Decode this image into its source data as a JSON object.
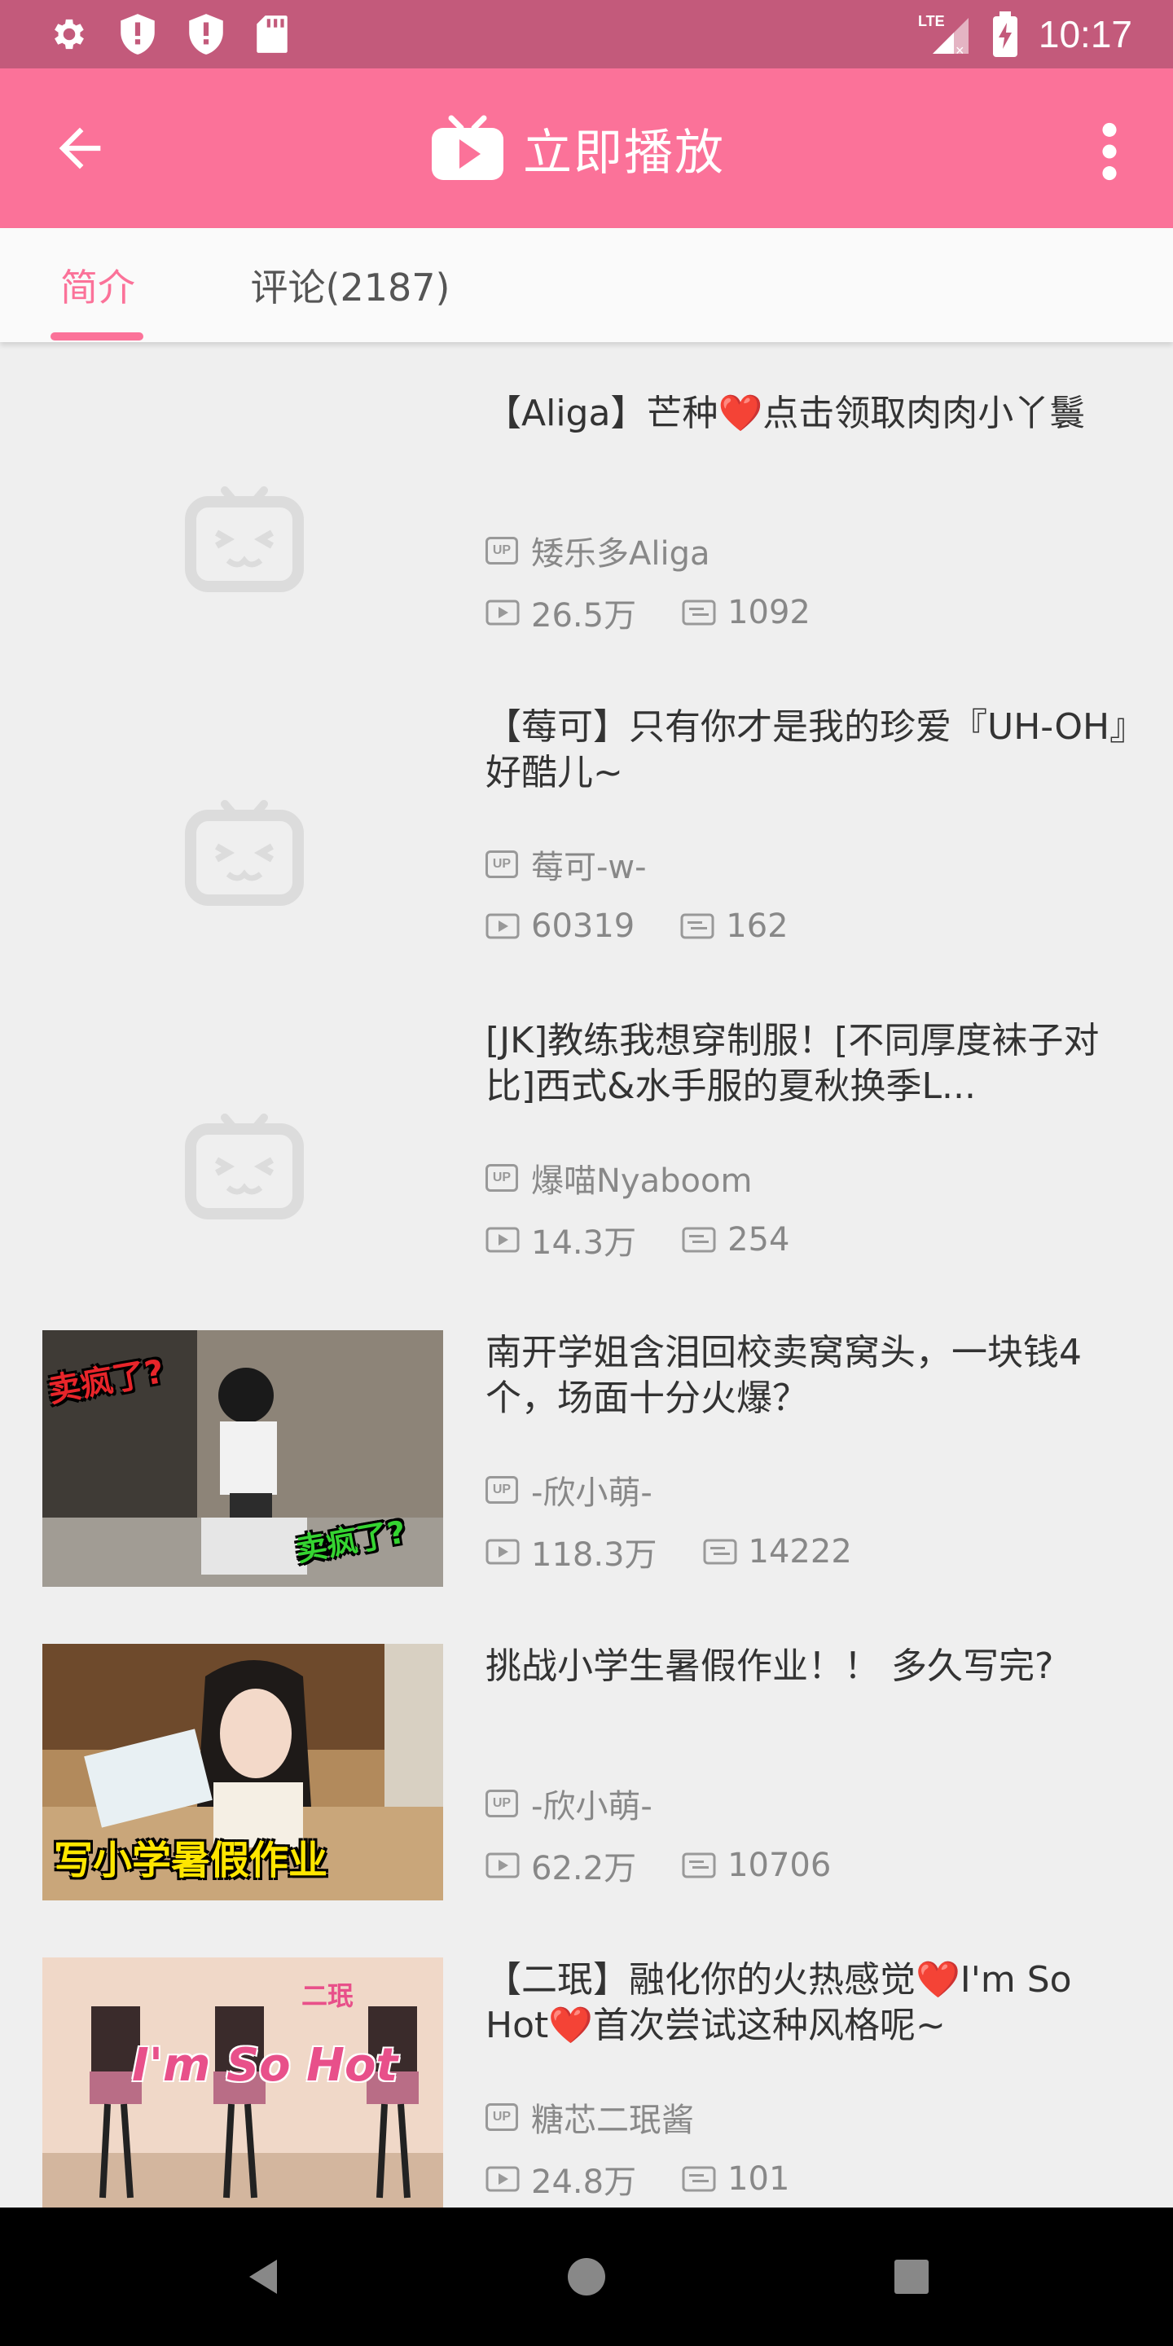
{
  "status_bar": {
    "time": "10:17",
    "network": "LTE",
    "icons": [
      "settings-icon",
      "shield-alert-icon",
      "shield-alert-icon",
      "sd-card-icon"
    ]
  },
  "app_bar": {
    "title": "立即播放",
    "back_icon": "arrow-back-icon",
    "logo_icon": "tv-play-icon",
    "more_icon": "more-vert-icon"
  },
  "tabs": [
    {
      "label": "简介",
      "active": true
    },
    {
      "label": "评论(2187)",
      "active": false
    }
  ],
  "videos": [
    {
      "title": "【Aliga】芒种❤️点击领取肉肉小丫鬟",
      "uploader": "矮乐多Aliga",
      "plays": "26.5万",
      "danmaku": "1092",
      "thumbnail": "placeholder"
    },
    {
      "title": "【莓可】只有你才是我的珍爱『UH-OH』好酷儿~",
      "uploader": "莓可-w-",
      "plays": "60319",
      "danmaku": "162",
      "thumbnail": "placeholder"
    },
    {
      "title": "[JK]教练我想穿制服！[不同厚度袜子对比]西式&水手服的夏秋换季L...",
      "uploader": "爆喵Nyaboom",
      "plays": "14.3万",
      "danmaku": "254",
      "thumbnail": "placeholder"
    },
    {
      "title": "南开学姐含泪回校卖窝窝头，一块钱4个，场面十分火爆？",
      "uploader": "-欣小萌-",
      "plays": "118.3万",
      "danmaku": "14222",
      "thumbnail": "photo",
      "thumb_captions": [
        "卖疯了?",
        "卖疯了?"
      ]
    },
    {
      "title": "挑战小学生暑假作业！！ 多久写完?",
      "uploader": "-欣小萌-",
      "plays": "62.2万",
      "danmaku": "10706",
      "thumbnail": "photo",
      "thumb_captions": [
        "写小学暑假作业"
      ]
    },
    {
      "title": "【二珉】融化你的火热感觉❤️I'm So Hot❤️首次尝试这种风格呢~",
      "uploader": "糖芯二珉酱",
      "plays": "24.8万",
      "danmaku": "101",
      "thumbnail": "photo",
      "thumb_captions": [
        "I'm So Hot",
        "二珉"
      ]
    }
  ],
  "labels": {
    "up_badge": "UP",
    "play_icon": "play-count-icon",
    "danmaku_icon": "danmaku-icon"
  },
  "colors": {
    "status_bar": "#c35a7b",
    "app_bar": "#fb7299",
    "accent": "#fb7299",
    "background": "#efefef"
  },
  "nav": {
    "buttons": [
      "back-triangle-icon",
      "home-circle-icon",
      "recents-square-icon"
    ]
  }
}
